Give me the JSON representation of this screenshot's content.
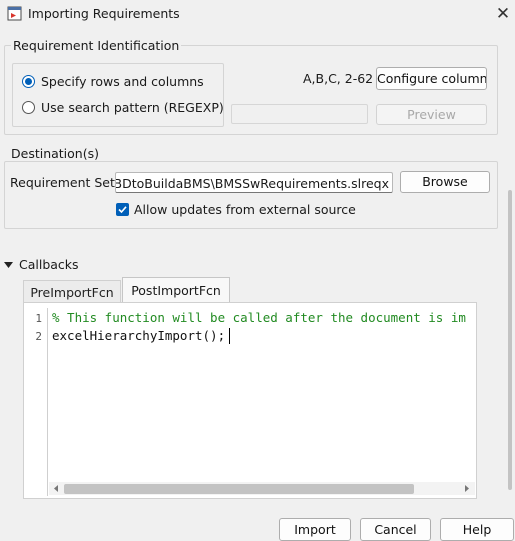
{
  "window": {
    "title": "Importing Requirements"
  },
  "identification": {
    "legend": "Requirement Identification",
    "radio_rows": "Specify rows and columns",
    "radio_search": "Use search pattern (REGEXP)",
    "columns_value": "A,B,C, 2-62",
    "configure_label": "Configure columns",
    "preview_label": "Preview",
    "pattern_value": ""
  },
  "destination": {
    "legend": "Destination(s)",
    "set_label": "Requirement Set:",
    "set_value": "seMBDtoBuildaBMS\\BMSSwRequirements.slreqx",
    "browse_label": "Browse",
    "allow_updates_label": "Allow updates from external source",
    "allow_updates_checked": true
  },
  "callbacks": {
    "header": "Callbacks",
    "tabs": [
      "PreImportFcn",
      "PostImportFcn"
    ],
    "active_tab": "PostImportFcn",
    "lines": [
      {
        "num": "1",
        "text": "% This function will be called after the document is im"
      },
      {
        "num": "2",
        "text": "excelHierarchyImport();"
      }
    ],
    "comment_color": "#228b22"
  },
  "footer": {
    "import_label": "Import",
    "cancel_label": "Cancel",
    "help_label": "Help"
  }
}
